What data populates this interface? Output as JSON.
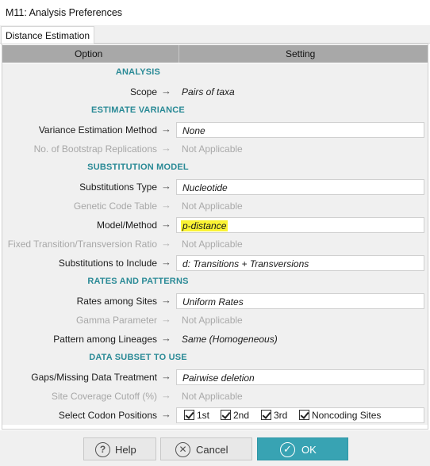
{
  "window": {
    "title": "M11: Analysis Preferences"
  },
  "tabs": [
    {
      "label": "Distance Estimation"
    }
  ],
  "grid": {
    "header": {
      "option": "Option",
      "setting": "Setting"
    },
    "sections": {
      "analysis": {
        "label": "ANALYSIS"
      },
      "estimate_variance": {
        "label": "ESTIMATE VARIANCE"
      },
      "substitution_model": {
        "label": "SUBSTITUTION MODEL"
      },
      "rates_and_patterns": {
        "label": "RATES AND PATTERNS"
      },
      "data_subset": {
        "label": "DATA SUBSET TO USE"
      }
    },
    "rows": {
      "scope": {
        "option": "Scope",
        "value": "Pairs of taxa"
      },
      "variance_method": {
        "option": "Variance Estimation Method",
        "value": "None"
      },
      "bootstrap_reps": {
        "option": "No. of Bootstrap Replications",
        "value": "Not Applicable"
      },
      "substitutions_type": {
        "option": "Substitutions Type",
        "value": "Nucleotide"
      },
      "genetic_code": {
        "option": "Genetic Code Table",
        "value": "Not Applicable"
      },
      "model_method": {
        "option": "Model/Method",
        "value": "p-distance"
      },
      "ts_tv_ratio": {
        "option": "Fixed Transition/Transversion Ratio",
        "value": "Not Applicable"
      },
      "substitutions_include": {
        "option": "Substitutions to Include",
        "value": "d: Transitions + Transversions"
      },
      "rates_among_sites": {
        "option": "Rates among Sites",
        "value": "Uniform Rates"
      },
      "gamma": {
        "option": "Gamma Parameter",
        "value": "Not Applicable"
      },
      "pattern_lineages": {
        "option": "Pattern among Lineages",
        "value": "Same (Homogeneous)"
      },
      "gaps_missing": {
        "option": "Gaps/Missing Data Treatment",
        "value": "Pairwise deletion"
      },
      "site_coverage": {
        "option": "Site Coverage Cutoff (%)",
        "value": "Not Applicable"
      },
      "codon_positions": {
        "option": "Select Codon Positions",
        "checkboxes": [
          {
            "label": "1st",
            "checked": true
          },
          {
            "label": "2nd",
            "checked": true
          },
          {
            "label": "3rd",
            "checked": true
          },
          {
            "label": "Noncoding Sites",
            "checked": true
          }
        ]
      }
    },
    "arrow_glyph": "→",
    "colors": {
      "section_text": "#2a8a96",
      "header_bg": "#a8a8a8",
      "highlight": "#fbf334",
      "ok_button": "#38a3b3"
    }
  },
  "footer": {
    "help": {
      "label": "Help",
      "icon": "help-icon",
      "glyph": "?"
    },
    "cancel": {
      "label": "Cancel",
      "icon": "close-icon",
      "glyph": "✕"
    },
    "ok": {
      "label": "OK",
      "icon": "check-icon",
      "glyph": "✓"
    }
  }
}
